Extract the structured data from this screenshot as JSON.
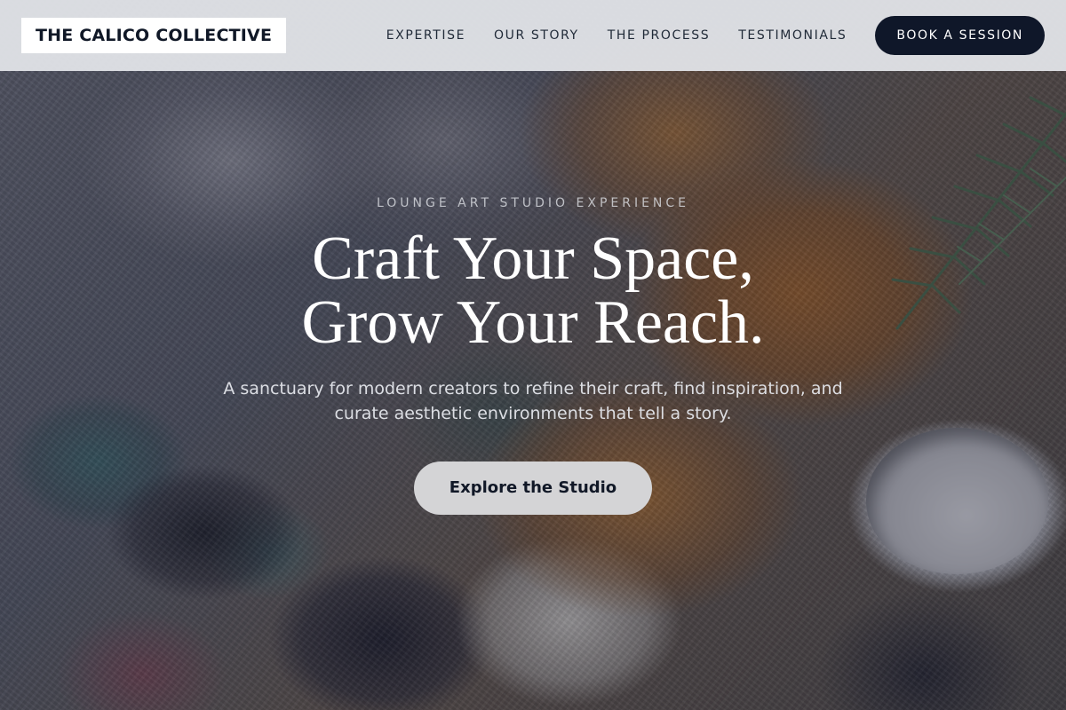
{
  "brand": {
    "name": "THE CALICO COLLECTIVE"
  },
  "nav": {
    "items": [
      {
        "label": "EXPERTISE"
      },
      {
        "label": "OUR STORY"
      },
      {
        "label": "THE PROCESS"
      },
      {
        "label": "TESTIMONIALS"
      }
    ],
    "cta_label": "BOOK A SESSION"
  },
  "hero": {
    "eyebrow": "LOUNGE ART STUDIO EXPERIENCE",
    "title_line1": "Craft Your Space,",
    "title_line2": "Grow Your Reach.",
    "subtitle": "A sanctuary for modern creators to refine their craft, find inspiration, and curate aesthetic environments that tell a story.",
    "button_label": "Explore the Studio"
  },
  "colors": {
    "header_bg": "#e2e4e8",
    "brand_dark": "#0f1729",
    "hero_button_bg": "#d4d4d6"
  }
}
